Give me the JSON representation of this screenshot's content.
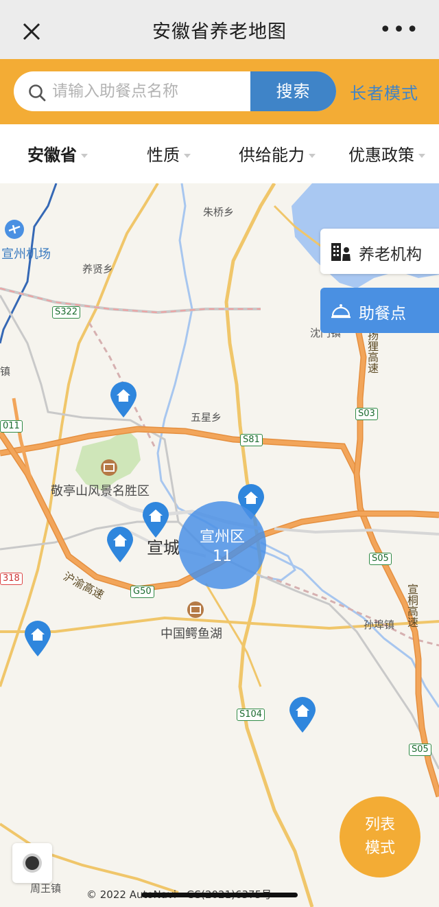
{
  "header": {
    "title": "安徽省养老地图",
    "more": "•••"
  },
  "search": {
    "placeholder": "请输入助餐点名称",
    "button": "搜索",
    "elder_mode": "长者模式"
  },
  "filters": [
    {
      "label": "安徽省"
    },
    {
      "label": "性质"
    },
    {
      "label": "供给能力"
    },
    {
      "label": "优惠政策"
    }
  ],
  "layers": {
    "institution": "养老机构",
    "meal_point": "助餐点"
  },
  "cluster": {
    "name": "宣州区",
    "count": "11"
  },
  "list_mode": {
    "line1": "列表",
    "line2": "模式"
  },
  "map_labels": {
    "airport": "宣州机场",
    "zhuqiao": "朱桥乡",
    "yangxian": "养贤乡",
    "wuxing": "五星乡",
    "shenqiao": "沈门镇",
    "jingting": "敬亭山风景名胜区",
    "xuancheng": "宣城",
    "eyu_lake": "中国鳄鱼湖",
    "sunbu": "孙埠镇",
    "zhouwang": "周王镇",
    "left_zhen": "镇",
    "huyu": "沪渝高速",
    "xuantong": "宣桐高速",
    "yangli": "扬狸高速"
  },
  "road_shields": {
    "s322": "S322",
    "s81": "S81",
    "s03": "S03",
    "s05a": "S05",
    "s05b": "S05",
    "g50": "G50",
    "s104": "S104",
    "s318": "318",
    "s011": "011"
  },
  "copyright": "© 2022 AutoNavi - GS(2021)6375号",
  "colors": {
    "accent": "#f3ac35",
    "primary_blue": "#3f84c8",
    "pin_blue": "#2f86dd",
    "highway": "#e9954a"
  }
}
